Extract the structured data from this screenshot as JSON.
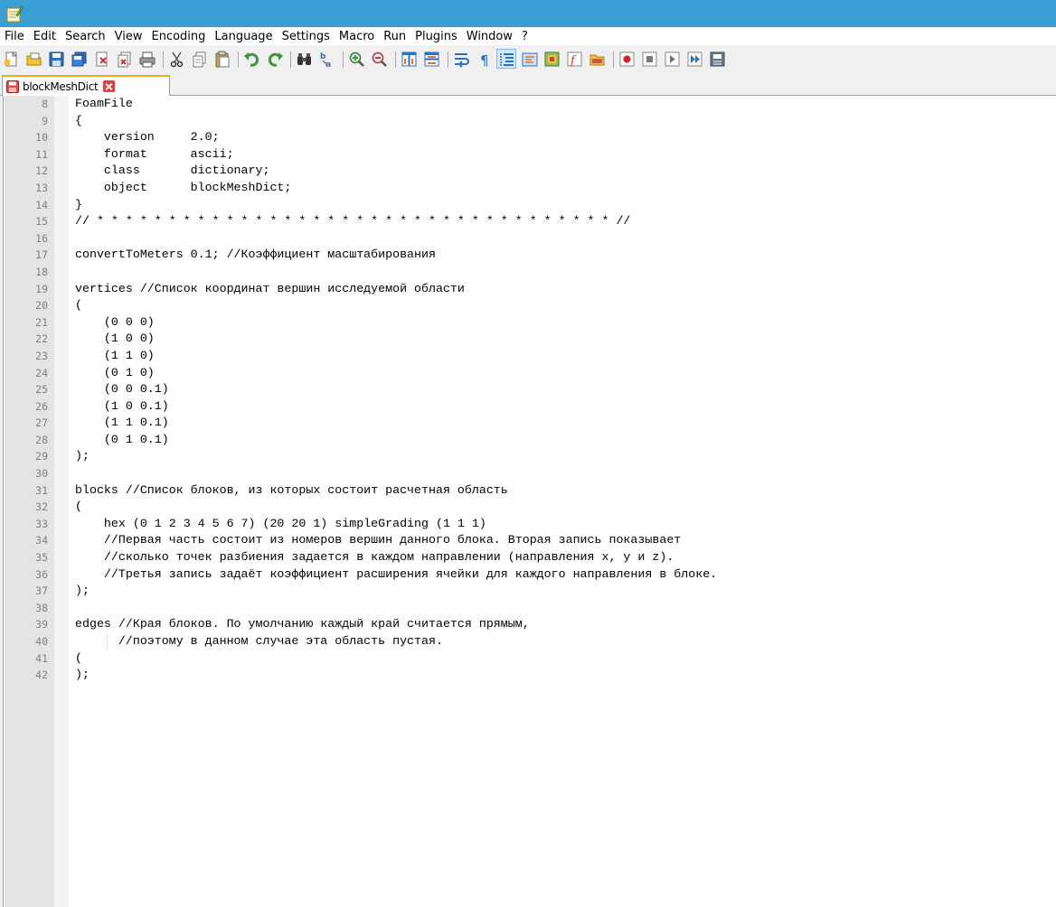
{
  "menu": [
    "File",
    "Edit",
    "Search",
    "View",
    "Encoding",
    "Language",
    "Settings",
    "Macro",
    "Run",
    "Plugins",
    "Window",
    "?"
  ],
  "toolbar": [
    {
      "name": "new-file-icon",
      "active": false
    },
    {
      "name": "open-file-icon",
      "active": false
    },
    {
      "name": "save-icon",
      "active": false
    },
    {
      "name": "save-all-icon",
      "active": false
    },
    {
      "name": "close-icon",
      "active": false
    },
    {
      "name": "close-all-icon",
      "active": false
    },
    {
      "name": "print-icon",
      "active": false
    },
    {
      "sep": true
    },
    {
      "name": "cut-icon",
      "active": false
    },
    {
      "name": "copy-icon",
      "active": false
    },
    {
      "name": "paste-icon",
      "active": false
    },
    {
      "sep": true
    },
    {
      "name": "undo-icon",
      "active": false
    },
    {
      "name": "redo-icon",
      "active": false
    },
    {
      "sep": true
    },
    {
      "name": "find-icon",
      "active": false
    },
    {
      "name": "replace-icon",
      "active": false
    },
    {
      "sep": true
    },
    {
      "name": "zoom-in-icon",
      "active": false
    },
    {
      "name": "zoom-out-icon",
      "active": false
    },
    {
      "sep": true
    },
    {
      "name": "sync-vertical-icon",
      "active": false
    },
    {
      "name": "sync-horizontal-icon",
      "active": false
    },
    {
      "sep": true
    },
    {
      "name": "word-wrap-icon",
      "active": false
    },
    {
      "name": "show-all-characters-icon",
      "active": false
    },
    {
      "name": "indent-guide-icon",
      "active": true
    },
    {
      "name": "user-defined-language-icon",
      "active": false
    },
    {
      "name": "document-map-icon",
      "active": false
    },
    {
      "name": "function-list-icon",
      "active": false
    },
    {
      "name": "folder-as-workspace-icon",
      "active": false
    },
    {
      "sep": true
    },
    {
      "name": "record-macro-icon",
      "active": false
    },
    {
      "name": "stop-recording-icon",
      "active": false
    },
    {
      "name": "playback-macro-icon",
      "active": false
    },
    {
      "name": "run-macro-multiple-icon",
      "active": false
    },
    {
      "name": "save-macro-icon",
      "active": false
    }
  ],
  "tab": {
    "label": "blockMeshDict"
  },
  "colors": {
    "titlebar": "#3b9fd6",
    "tab_accent": "#f4a623",
    "gutter": "#e4e4e4",
    "line_numbers": "#808080"
  },
  "lines": [
    {
      "n": "8",
      "text": "FoamFile"
    },
    {
      "n": "9",
      "text": "{"
    },
    {
      "n": "10",
      "text": "    version     2.0;"
    },
    {
      "n": "11",
      "text": "    format      ascii;"
    },
    {
      "n": "12",
      "text": "    class       dictionary;"
    },
    {
      "n": "13",
      "text": "    object      blockMeshDict;"
    },
    {
      "n": "14",
      "text": "}"
    },
    {
      "n": "15",
      "text": "// * * * * * * * * * * * * * * * * * * * * * * * * * * * * * * * * * * * * //"
    },
    {
      "n": "16",
      "text": ""
    },
    {
      "n": "17",
      "text": "convertToMeters 0.1; //Коэффициент масштабирования"
    },
    {
      "n": "18",
      "text": ""
    },
    {
      "n": "19",
      "text": "vertices //Список координат вершин исследуемой области"
    },
    {
      "n": "20",
      "text": "("
    },
    {
      "n": "21",
      "text": "    (0 0 0)"
    },
    {
      "n": "22",
      "text": "    (1 0 0)"
    },
    {
      "n": "23",
      "text": "    (1 1 0)"
    },
    {
      "n": "24",
      "text": "    (0 1 0)"
    },
    {
      "n": "25",
      "text": "    (0 0 0.1)"
    },
    {
      "n": "26",
      "text": "    (1 0 0.1)"
    },
    {
      "n": "27",
      "text": "    (1 1 0.1)"
    },
    {
      "n": "28",
      "text": "    (0 1 0.1)"
    },
    {
      "n": "29",
      "text": ");"
    },
    {
      "n": "30",
      "text": ""
    },
    {
      "n": "31",
      "text": "blocks //Список блоков, из которых состоит расчетная область"
    },
    {
      "n": "32",
      "text": "("
    },
    {
      "n": "33",
      "text": "    hex (0 1 2 3 4 5 6 7) (20 20 1) simpleGrading (1 1 1)"
    },
    {
      "n": "34",
      "text": "    //Первая часть состоит из номеров вершин данного блока. Вторая запись показывает"
    },
    {
      "n": "35",
      "text": "    //сколько точек разбиения задается в каждом направлении (направления x, y и z)."
    },
    {
      "n": "36",
      "text": "    //Третья запись задаёт коэффициент расширения ячейки для каждого направления в блоке."
    },
    {
      "n": "37",
      "text": ");"
    },
    {
      "n": "38",
      "text": ""
    },
    {
      "n": "39",
      "text": "edges //Края блоков. По умолчанию каждый край считается прямым,"
    },
    {
      "n": "40",
      "text": "      //поэтому в данном случае эта область пустая.",
      "guide": true
    },
    {
      "n": "41",
      "text": "("
    },
    {
      "n": "42",
      "text": ");"
    }
  ]
}
